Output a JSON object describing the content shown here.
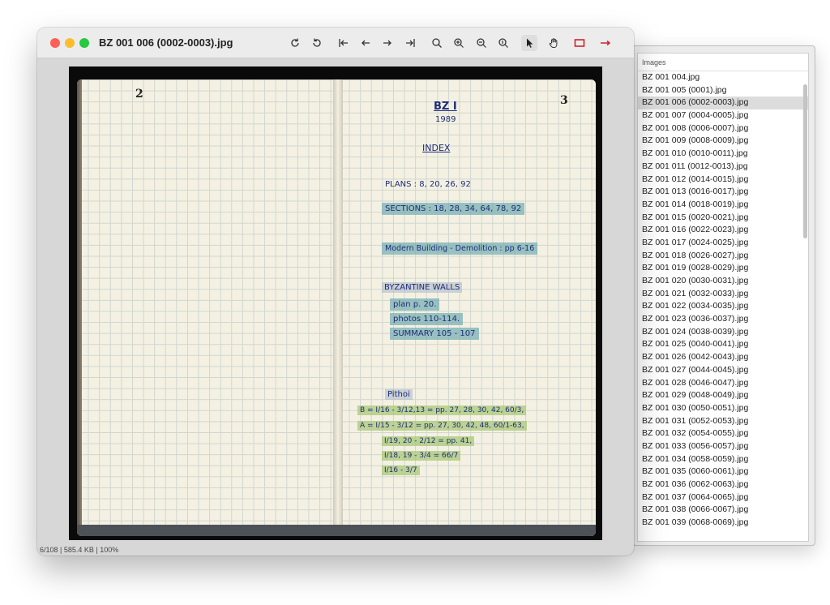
{
  "window": {
    "title": "BZ 001 006 (0002-0003).jpg"
  },
  "toolbar": [
    {
      "id": "rotate-cw",
      "icon": "rotate-clockwise-icon"
    },
    {
      "id": "rotate-ccw",
      "icon": "rotate-counterclockwise-icon"
    },
    {
      "id": "first",
      "icon": "first-image-icon"
    },
    {
      "id": "prev",
      "icon": "previous-image-icon"
    },
    {
      "id": "next",
      "icon": "next-image-icon"
    },
    {
      "id": "last",
      "icon": "last-image-icon"
    },
    {
      "id": "zoom-fit",
      "icon": "zoom-icon"
    },
    {
      "id": "zoom-in",
      "icon": "zoom-in-icon"
    },
    {
      "id": "zoom-out",
      "icon": "zoom-out-icon"
    },
    {
      "id": "zoom-actual",
      "icon": "zoom-actual-size-icon"
    },
    {
      "id": "select",
      "icon": "pointer-icon",
      "active": true
    },
    {
      "id": "pan",
      "icon": "hand-icon"
    },
    {
      "id": "rectangle",
      "icon": "rectangle-icon",
      "color": "#d0242c"
    },
    {
      "id": "arrow",
      "icon": "arrow-icon",
      "color": "#d0242c"
    }
  ],
  "status": {
    "text": "6/108  |  585.4 KB  |  100%"
  },
  "notebook": {
    "left_page_number": "2",
    "right_page_number": "3",
    "lines": [
      {
        "text": "BZ I",
        "style": "title"
      },
      {
        "text": "1989",
        "style": "plain"
      },
      {
        "text": "INDEX",
        "style": "underline"
      },
      {
        "text": "PLANS : 8, 20, 26, 92",
        "style": "plain"
      },
      {
        "text": "SECTIONS : 18, 28, 34, 64, 78, 92",
        "style": "blue"
      },
      {
        "text": "Modern Building - Demolition : pp 6-16",
        "style": "blue"
      },
      {
        "text": "BYZANTINE WALLS",
        "style": "gray"
      },
      {
        "text": "plan  p. 20.",
        "style": "blue"
      },
      {
        "text": "photos  110-114.",
        "style": "blue"
      },
      {
        "text": "SUMMARY  105 - 107",
        "style": "blue"
      },
      {
        "text": "Pithoi",
        "style": "gray"
      },
      {
        "text": "B =  I/16 - 3/12,13 = pp. 27, 28, 30, 42, 60/3,",
        "style": "green"
      },
      {
        "text": "A =  I/15 - 3/12 = pp. 27, 30, 42, 48, 60/1-63,",
        "style": "green"
      },
      {
        "text": "I/19, 20 - 2/12 = pp. 41,",
        "style": "green"
      },
      {
        "text": "I/18, 19 - 3/4 = 66/7",
        "style": "green"
      },
      {
        "text": "I/16 - 3/7",
        "style": "green"
      }
    ]
  },
  "images_panel": {
    "header": "Images",
    "selected_index": 2,
    "items": [
      "BZ 001 004.jpg",
      "BZ 001 005 (0001).jpg",
      "BZ 001 006 (0002-0003).jpg",
      "BZ 001 007 (0004-0005).jpg",
      "BZ 001 008 (0006-0007).jpg",
      "BZ 001 009 (0008-0009).jpg",
      "BZ 001 010 (0010-0011).jpg",
      "BZ 001 011 (0012-0013).jpg",
      "BZ 001 012 (0014-0015).jpg",
      "BZ 001 013 (0016-0017).jpg",
      "BZ 001 014 (0018-0019).jpg",
      "BZ 001 015 (0020-0021).jpg",
      "BZ 001 016 (0022-0023).jpg",
      "BZ 001 017 (0024-0025).jpg",
      "BZ 001 018 (0026-0027).jpg",
      "BZ 001 019 (0028-0029).jpg",
      "BZ 001 020 (0030-0031).jpg",
      "BZ 001 021 (0032-0033).jpg",
      "BZ 001 022 (0034-0035).jpg",
      "BZ 001 023 (0036-0037).jpg",
      "BZ 001 024 (0038-0039).jpg",
      "BZ 001 025 (0040-0041).jpg",
      "BZ 001 026 (0042-0043).jpg",
      "BZ 001 027 (0044-0045).jpg",
      "BZ 001 028 (0046-0047).jpg",
      "BZ 001 029 (0048-0049).jpg",
      "BZ 001 030 (0050-0051).jpg",
      "BZ 001 031 (0052-0053).jpg",
      "BZ 001 032 (0054-0055).jpg",
      "BZ 001 033 (0056-0057).jpg",
      "BZ 001 034 (0058-0059).jpg",
      "BZ 001 035 (0060-0061).jpg",
      "BZ 001 036 (0062-0063).jpg",
      "BZ 001 037 (0064-0065).jpg",
      "BZ 001 038 (0066-0067).jpg",
      "BZ 001 039 (0068-0069).jpg"
    ]
  }
}
